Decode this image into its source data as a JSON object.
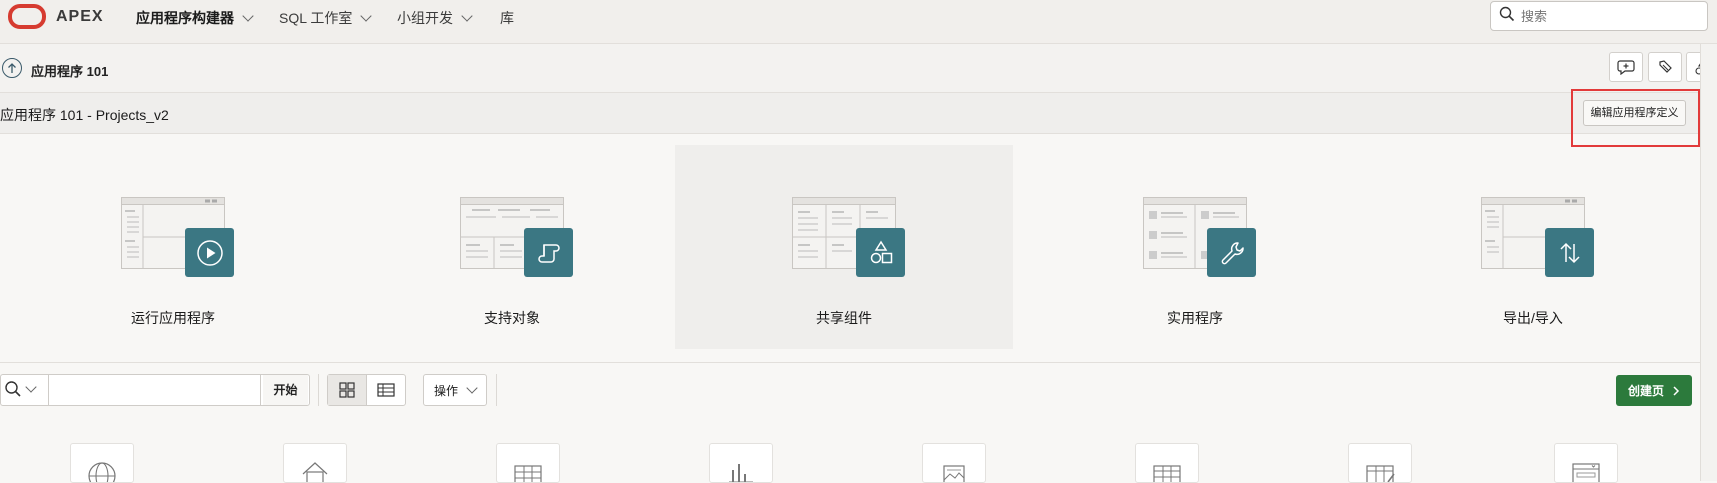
{
  "brand": {
    "name": "APEX"
  },
  "nav": {
    "items": [
      {
        "label": "应用程序构建器",
        "active": true
      },
      {
        "label": "SQL 工作室",
        "active": false
      },
      {
        "label": "小组开发",
        "active": false
      },
      {
        "label": "库",
        "active": false
      }
    ]
  },
  "search": {
    "placeholder": "搜索",
    "value": ""
  },
  "breadcrumb": {
    "label": "应用程序 101"
  },
  "toolbar_icons": [
    "comment-add-icon",
    "flashlight-icon",
    "shapes-icon"
  ],
  "region": {
    "title": "应用程序 101 - Projects_v2",
    "edit_button": "编辑应用程序定义"
  },
  "cards": [
    {
      "label": "运行应用程序",
      "icon": "play-icon",
      "selected": false
    },
    {
      "label": "支持对象",
      "icon": "scroll-icon",
      "selected": false
    },
    {
      "label": "共享组件",
      "icon": "shapes-icon",
      "selected": true
    },
    {
      "label": "实用程序",
      "icon": "wrench-icon",
      "selected": false
    },
    {
      "label": "导出/导入",
      "icon": "transfer-icon",
      "selected": false
    }
  ],
  "page_toolbar": {
    "filter_value": "",
    "go_button": "开始",
    "actions_button": "操作",
    "create_button": "创建页",
    "view_mode": "icons"
  },
  "page_tiles": [
    "globe-icon",
    "home-icon",
    "table-icon",
    "chart-icon",
    "image-icon",
    "grid-icon",
    "grid-edit-icon",
    "form-icon"
  ],
  "colors": {
    "accent": "#3b7783",
    "create_button": "#2c7a3c",
    "logo": "#d63b30",
    "highlight": "#e23a3a"
  }
}
